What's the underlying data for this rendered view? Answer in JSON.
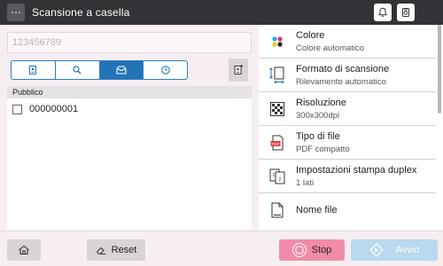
{
  "topbar": {
    "menu_glyph": "⋯",
    "title": "Scansione a casella",
    "icons": [
      "bell-icon",
      "settings-icon"
    ]
  },
  "destination": {
    "value": "123456789"
  },
  "tabs": [
    {
      "name": "address-book-icon",
      "active": false
    },
    {
      "name": "search-icon",
      "active": false
    },
    {
      "name": "box-icon",
      "active": true
    },
    {
      "name": "history-icon",
      "active": false
    }
  ],
  "list": {
    "header": "Pubblico",
    "items": [
      {
        "label": "000000001",
        "checked": false
      }
    ]
  },
  "settings": [
    {
      "name": "Colore",
      "value": "Colore automatico",
      "icon": "color-icon"
    },
    {
      "name": "Formato di scansione",
      "value": "Rilevamento automatico",
      "icon": "scan-size-icon"
    },
    {
      "name": "Risoluzione",
      "value": "300x300dpi",
      "icon": "resolution-icon"
    },
    {
      "name": "Tipo di file",
      "value": "PDF compatto",
      "icon": "pdf-file-icon"
    },
    {
      "name": "Impostazioni stampa duplex",
      "value": "1 lati",
      "icon": "duplex-icon"
    },
    {
      "name": "Nome file",
      "value": "",
      "icon": "file-name-icon"
    }
  ],
  "bottom": {
    "reset_label": "Reset",
    "stop_label": "Stop",
    "start_label": "Avvio"
  },
  "colors": {
    "topbar": "#333236",
    "accent": "#2573b7",
    "stop": "#f18ba8",
    "start": "#b9d9ee",
    "background": "#f7eef2"
  }
}
